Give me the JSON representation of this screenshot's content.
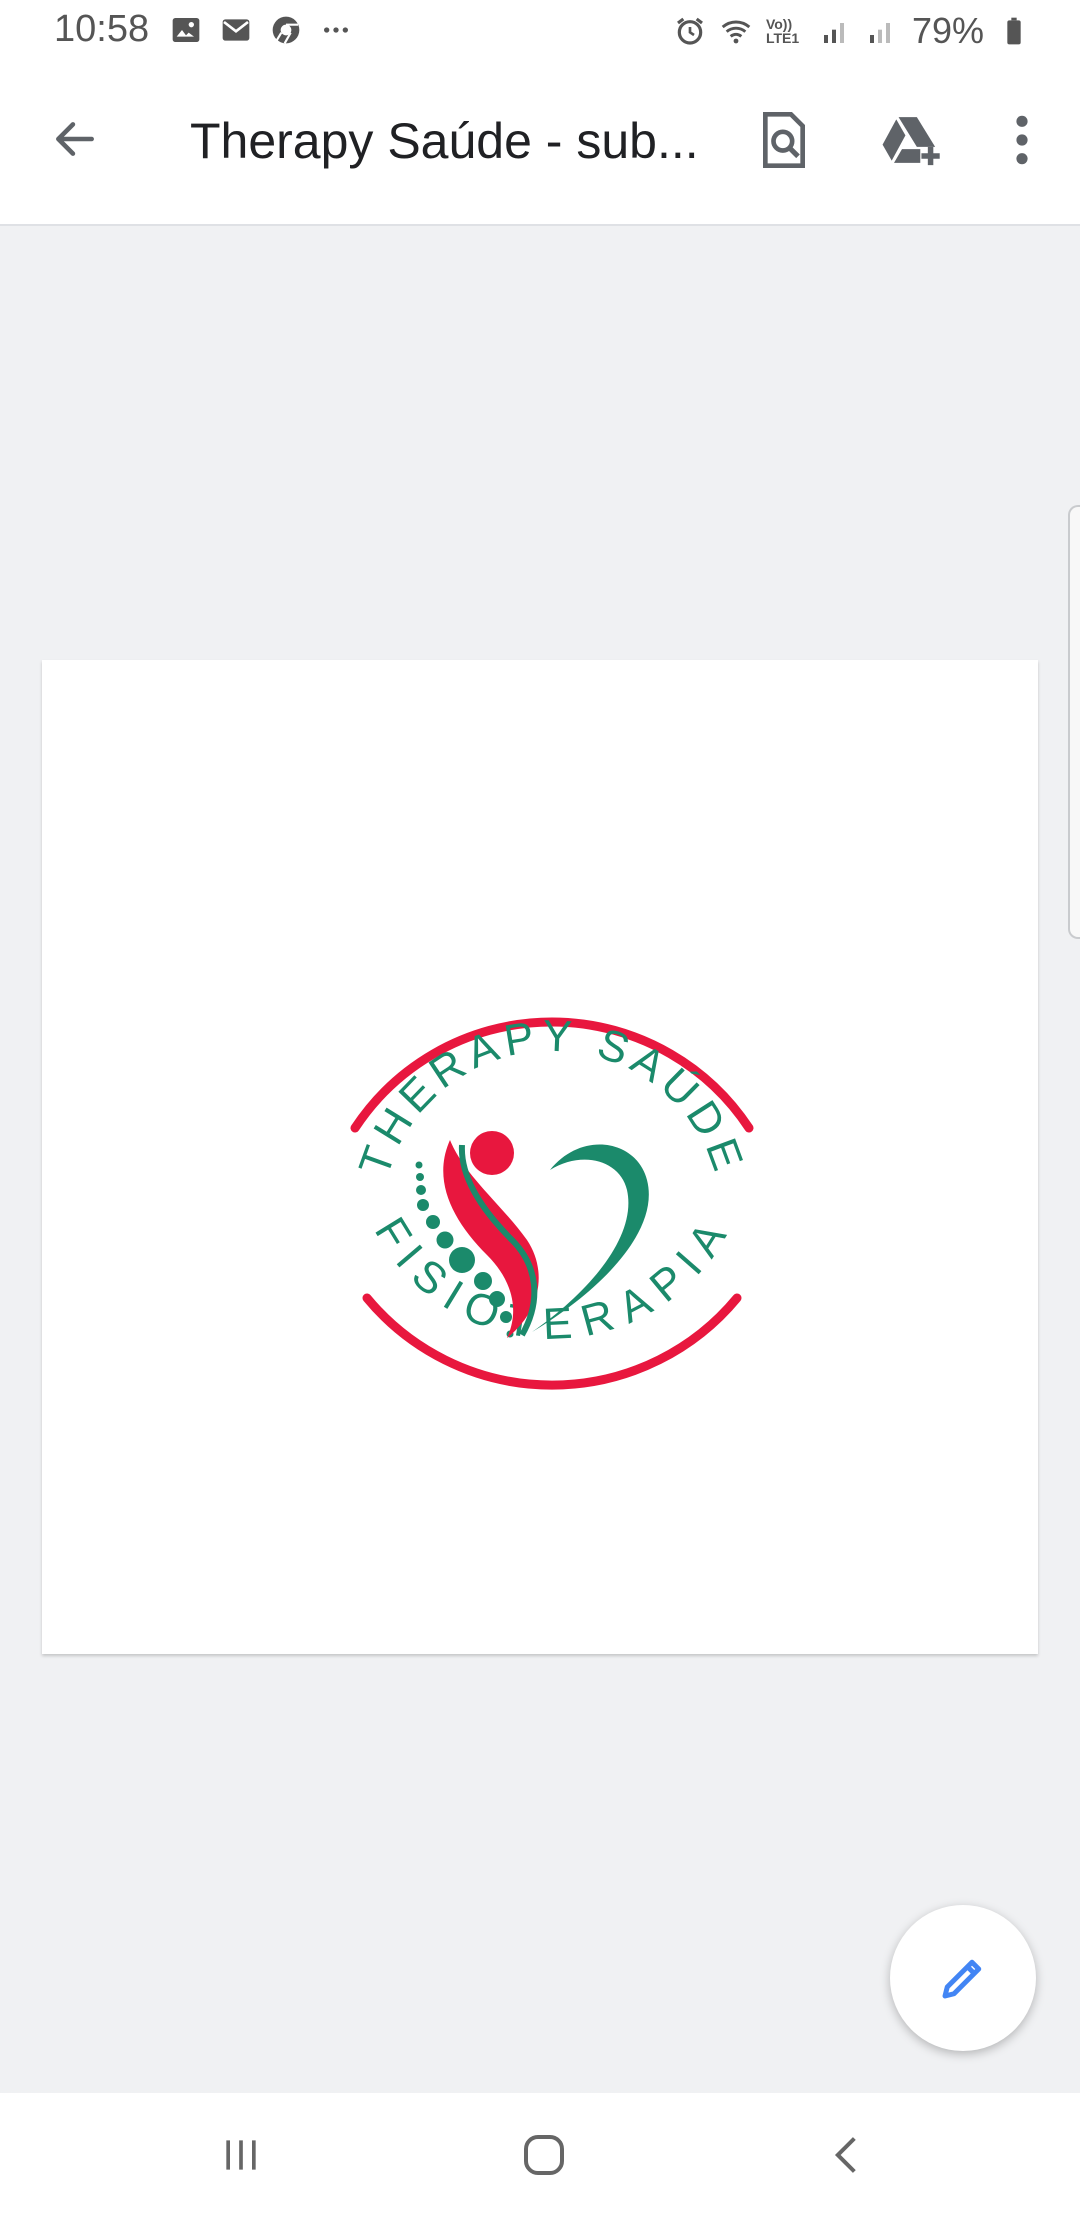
{
  "status_bar": {
    "time": "10:58",
    "battery": "79%",
    "left_icons": [
      "image-icon",
      "mail-icon",
      "chrome-icon",
      "more-dots-icon"
    ],
    "right_icons": [
      "alarm-icon",
      "wifi-icon",
      "volte-icon",
      "signal-icon",
      "signal-icon",
      "battery-icon"
    ],
    "volte_label": "Vo)) LTE1"
  },
  "app_bar": {
    "title": "Therapy Saúde - sub...",
    "back_icon": "arrow-back-icon",
    "actions": [
      "find-in-document-icon",
      "add-to-drive-icon",
      "more-vert-icon"
    ]
  },
  "document": {
    "logo": {
      "top_text": "THERAPY SAÚDE",
      "bottom_text": "FISIOTERAPIA"
    }
  },
  "fab": {
    "icon": "edit-pencil-icon"
  },
  "nav_bar": {
    "buttons": [
      "recents-icon",
      "home-icon",
      "back-icon"
    ]
  },
  "colors": {
    "brand_red": "#e8173e",
    "brand_green": "#1b8a6b",
    "fab_accent": "#4285f4"
  }
}
